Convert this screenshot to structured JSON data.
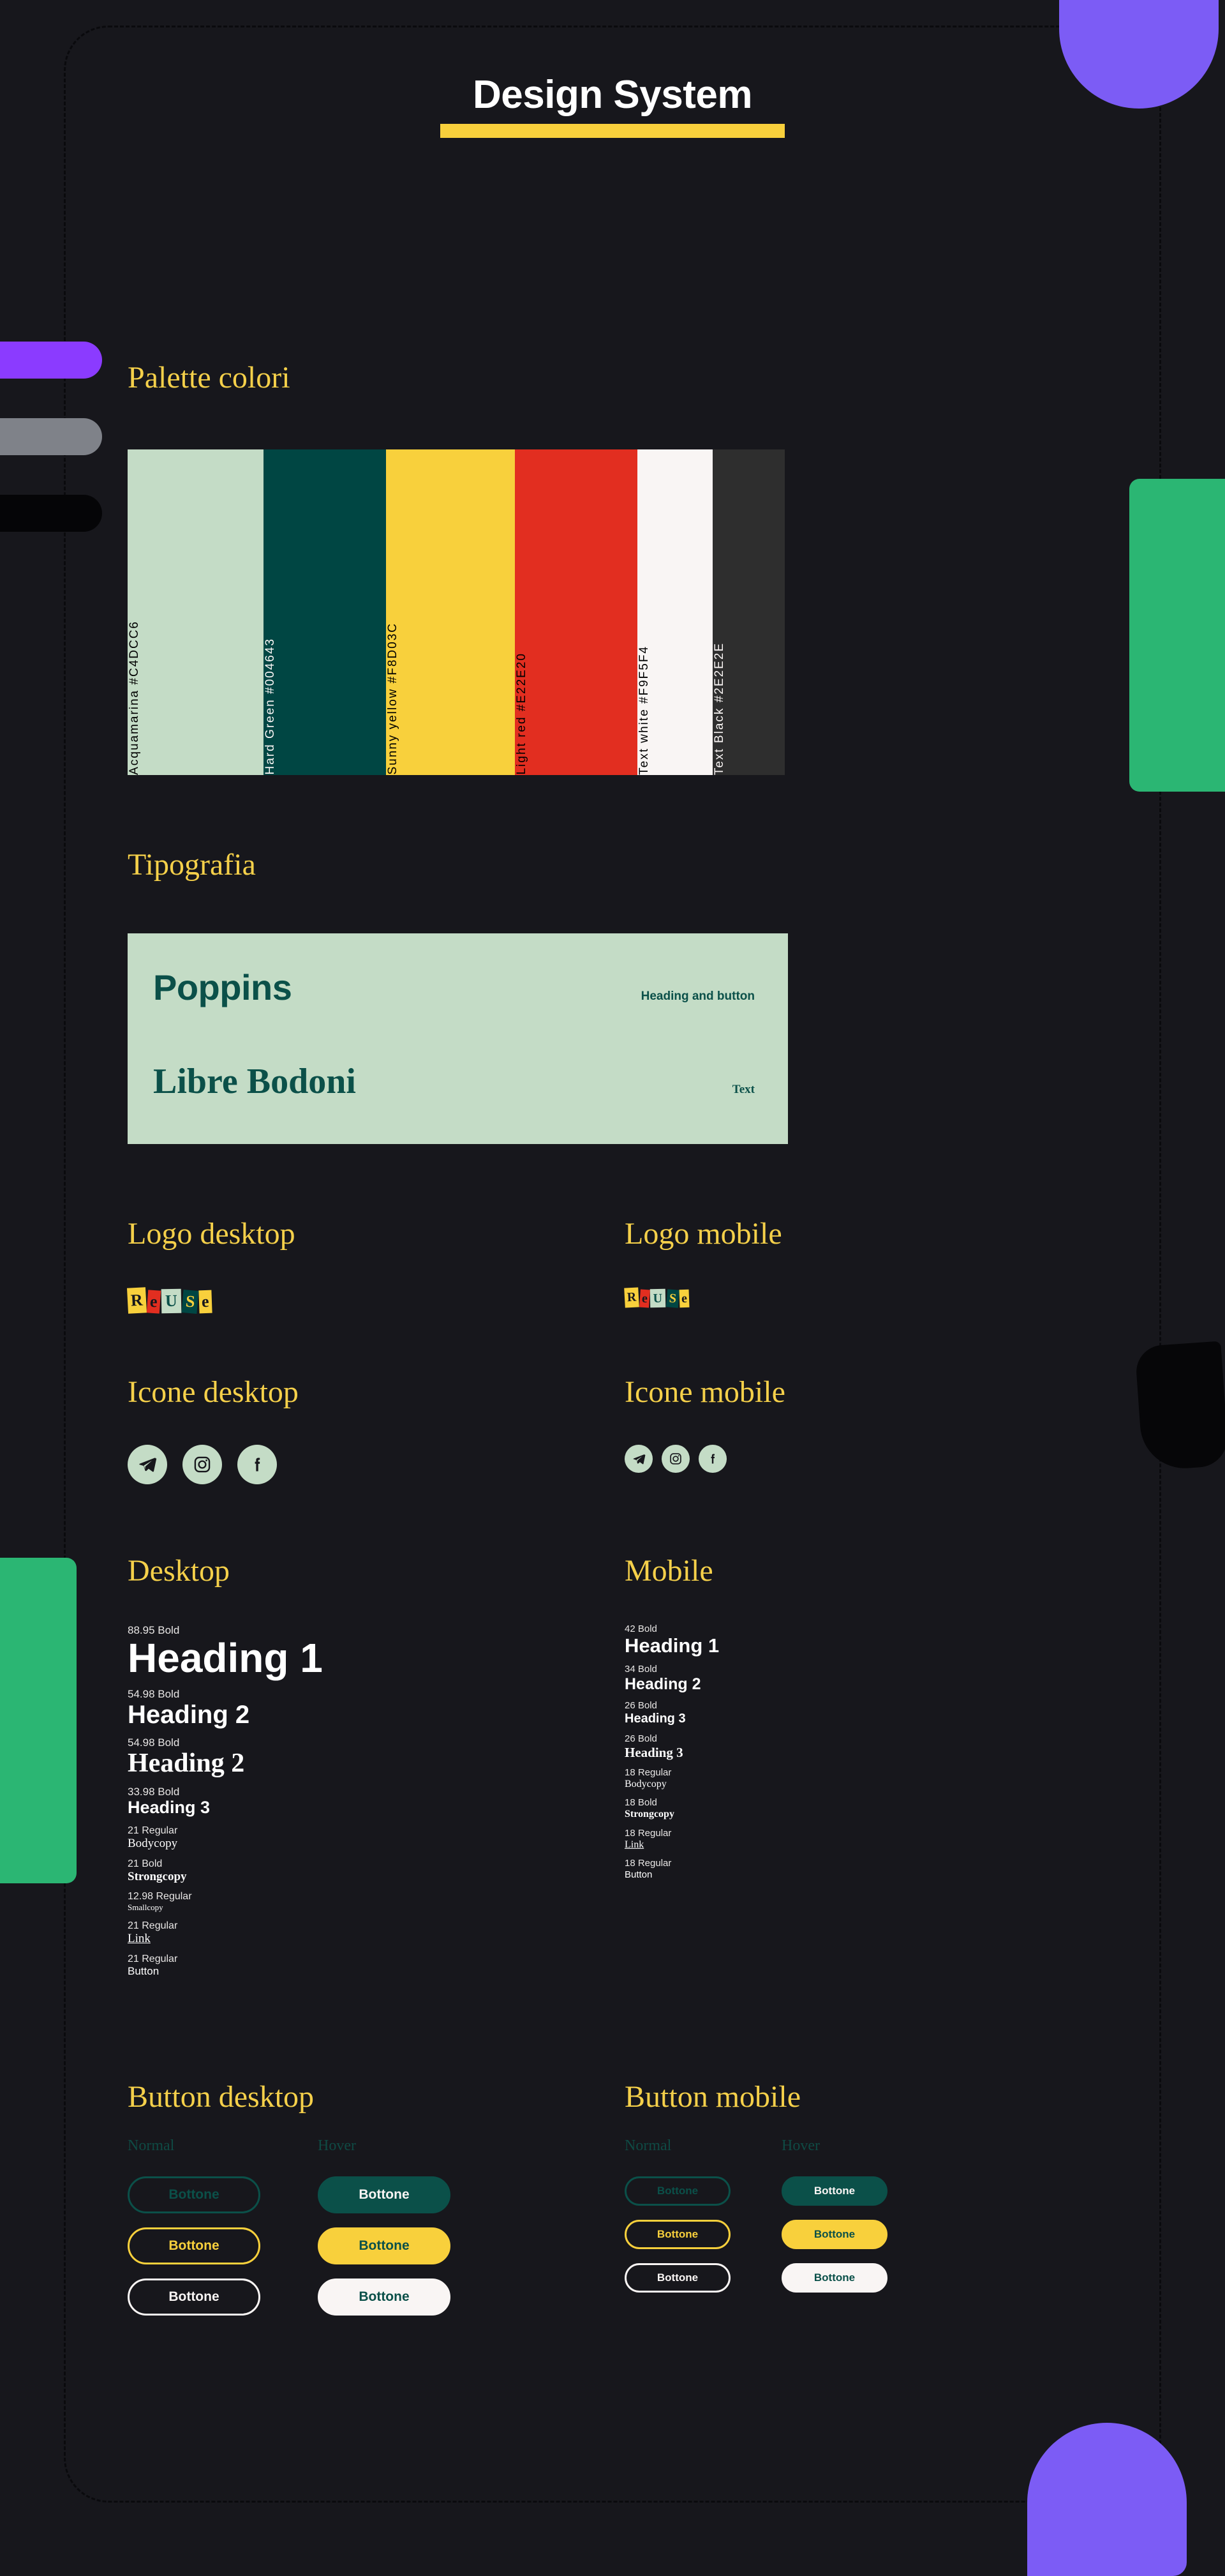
{
  "header": {
    "title": "Design System",
    "rule_color": "#F8D03C"
  },
  "sections": {
    "palette_title": "Palette colori",
    "typography_title": "Tipografia",
    "logo_desktop_title": "Logo desktop",
    "logo_mobile_title": "Logo mobile",
    "icons_desktop_title": "Icone desktop",
    "icons_mobile_title": "Icone mobile",
    "scale_desktop_title": "Desktop",
    "scale_mobile_title": "Mobile",
    "buttons_desktop_title": "Button desktop",
    "buttons_mobile_title": "Button mobile"
  },
  "palette": [
    {
      "name": "Acquamarina",
      "hex": "#C4DCC6",
      "label": "Acquamarina #C4DCC6",
      "text_color": "#17171c"
    },
    {
      "name": "Hard Green",
      "hex": "#004643",
      "label": "Hard Green #004643",
      "text_color": "#F9F5F4"
    },
    {
      "name": "Sunny yellow",
      "hex": "#F8D03C",
      "label": "Sunny yellow #F8D03C",
      "text_color": "#17171c"
    },
    {
      "name": "Light red",
      "hex": "#E22E20",
      "label": "Light red #E22E20",
      "text_color": "#17171c"
    },
    {
      "name": "Text white",
      "hex": "#F9F5F4",
      "label": "Text white #F9F5F4",
      "text_color": "#17171c"
    },
    {
      "name": "Text Black",
      "hex": "#2E2E2E",
      "label": "Text Black #2E2E2E",
      "text_color": "#F9F5F4"
    }
  ],
  "typography": {
    "primary_font": "Poppins",
    "primary_usage": "Heading and button",
    "secondary_font": "Libre Bodoni",
    "secondary_usage": "Text",
    "card_bg": "#C4DCC6",
    "card_text": "#0b5049"
  },
  "logo": {
    "text": "ReUSe",
    "letters": [
      {
        "char": "R",
        "bg": "#F8D03C",
        "color": "#17171c"
      },
      {
        "char": "e",
        "bg": "#E22E20",
        "color": "#17171c"
      },
      {
        "char": "U",
        "bg": "#C4DCC6",
        "color": "#0b5049"
      },
      {
        "char": "S",
        "bg": "#004643",
        "color": "#F8D03C"
      },
      {
        "char": "e",
        "bg": "#F8D03C",
        "color": "#17171c"
      }
    ]
  },
  "icons": {
    "items": [
      "telegram-icon",
      "instagram-icon",
      "facebook-icon"
    ],
    "circle_bg": "#C4DCC6",
    "glyph_color": "#17171c"
  },
  "scale_desktop": [
    {
      "meta": "88.95 Bold",
      "sample": "Heading 1",
      "font": "sans",
      "weight": "bold",
      "size": 64,
      "meta_size": 17
    },
    {
      "meta": "54.98 Bold",
      "sample": "Heading 2",
      "font": "sans",
      "weight": "bold",
      "size": 40,
      "meta_size": 17
    },
    {
      "meta": "54.98 Bold",
      "sample": "Heading 2",
      "font": "serif",
      "weight": "bold",
      "size": 42,
      "meta_size": 17
    },
    {
      "meta": "33.98 Bold",
      "sample": "Heading 3",
      "font": "sans",
      "weight": "bold",
      "size": 27,
      "meta_size": 17
    },
    {
      "meta": "21 Regular",
      "sample": "Bodycopy",
      "font": "serif",
      "weight": "normal",
      "size": 19,
      "meta_size": 16
    },
    {
      "meta": "21 Bold",
      "sample": "Strongcopy",
      "font": "serif",
      "weight": "bold",
      "size": 19,
      "meta_size": 16
    },
    {
      "meta": "12.98 Regular",
      "sample": "Smallcopy",
      "font": "serif",
      "weight": "normal",
      "size": 13,
      "meta_size": 16
    },
    {
      "meta": "21 Regular",
      "sample": "Link",
      "font": "serif",
      "weight": "normal",
      "size": 19,
      "meta_size": 16,
      "underline": true
    },
    {
      "meta": "21 Regular",
      "sample": "Button",
      "font": "sans",
      "weight": "normal",
      "size": 17,
      "meta_size": 16
    }
  ],
  "scale_mobile": [
    {
      "meta": "42 Bold",
      "sample": "Heading 1",
      "font": "sans",
      "weight": "bold",
      "size": 31,
      "meta_size": 15
    },
    {
      "meta": "34 Bold",
      "sample": "Heading 2",
      "font": "sans",
      "weight": "bold",
      "size": 25,
      "meta_size": 15
    },
    {
      "meta": "26 Bold",
      "sample": "Heading 3",
      "font": "sans",
      "weight": "bold",
      "size": 20,
      "meta_size": 15
    },
    {
      "meta": "26 Bold",
      "sample": "Heading 3",
      "font": "serif",
      "weight": "bold",
      "size": 21,
      "meta_size": 15
    },
    {
      "meta": "18 Regular",
      "sample": "Bodycopy",
      "font": "serif",
      "weight": "normal",
      "size": 16,
      "meta_size": 15
    },
    {
      "meta": "18 Bold",
      "sample": "Strongcopy",
      "font": "serif",
      "weight": "bold",
      "size": 16,
      "meta_size": 15
    },
    {
      "meta": "18 Regular",
      "sample": "Link",
      "font": "serif",
      "weight": "normal",
      "size": 16,
      "meta_size": 15,
      "underline": true
    },
    {
      "meta": "18 Regular",
      "sample": "Button",
      "font": "sans",
      "weight": "normal",
      "size": 15,
      "meta_size": 15
    }
  ],
  "buttons": {
    "state_normal": "Normal",
    "state_hover": "Hover",
    "label": "Bottone",
    "variants": [
      "green",
      "yellow",
      "white"
    ]
  },
  "decor_colors": {
    "background": "#17171c",
    "purple": "#7c5cf5",
    "purple_pill": "#8b3bff",
    "gray_pill": "#7f8289",
    "black_pill": "#050507",
    "green_rect": "#2bb673"
  }
}
